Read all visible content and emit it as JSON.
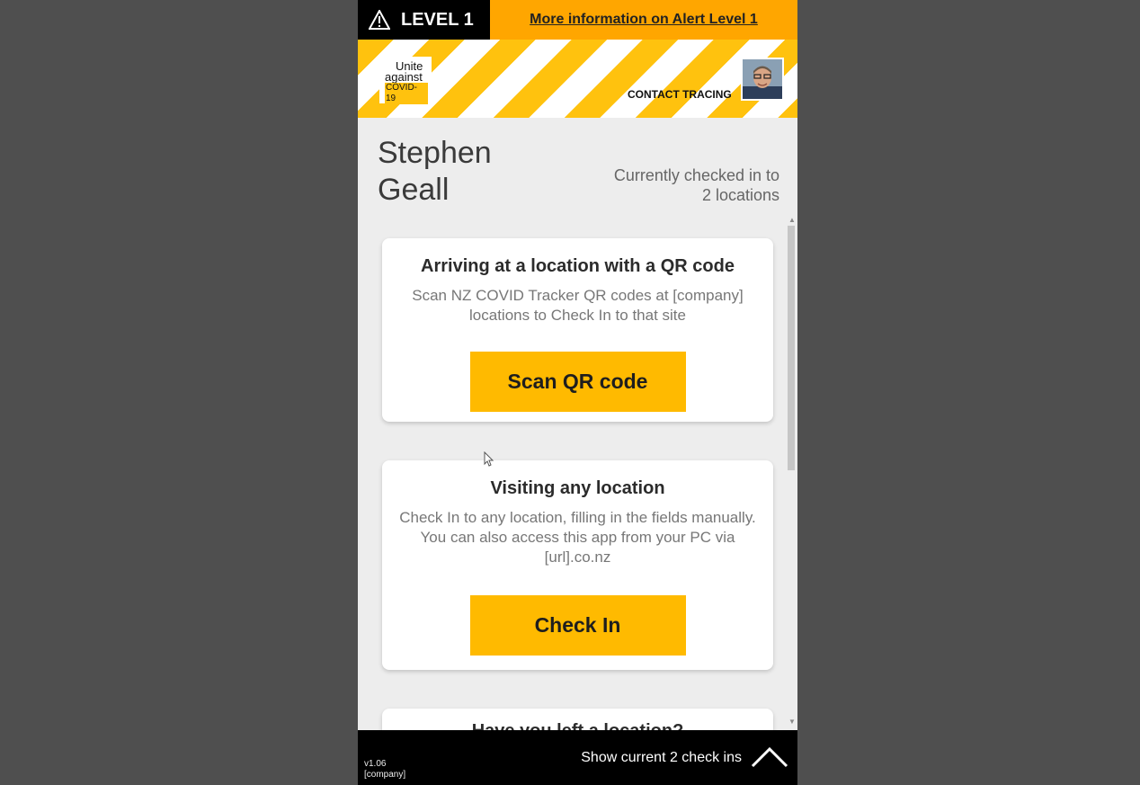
{
  "alert": {
    "level": "LEVEL 1",
    "more_info": "More information on Alert Level 1"
  },
  "banner": {
    "logo_line1": "Unite",
    "logo_line2": "against",
    "logo_line3": "COVID-19",
    "contact_tracing": "CONTACT TRACING"
  },
  "user": {
    "first_name": "Stephen",
    "last_name": "Geall",
    "checked_in_line1": "Currently checked in to",
    "checked_in_line2": "2 locations"
  },
  "cards": [
    {
      "title": "Arriving at a location with a QR code",
      "description": "Scan NZ COVID Tracker QR codes at [company] locations to Check In to that site",
      "button": "Scan QR code"
    },
    {
      "title": "Visiting any location",
      "description": "Check In to any location, filling in the fields manually. You can also access this app from your PC via [url].co.nz",
      "button": "Check In"
    },
    {
      "title": "Have you left a location?"
    }
  ],
  "footer": {
    "version": "v1.06",
    "company": "[company]",
    "show_checkins": "Show current 2 check ins"
  },
  "colors": {
    "alert_orange": "#ffa600",
    "hazard_yellow": "#ffc20e",
    "button_yellow": "#ffba00"
  },
  "icons": [
    "warning-icon",
    "chevron-up-icon",
    "cursor-icon"
  ]
}
